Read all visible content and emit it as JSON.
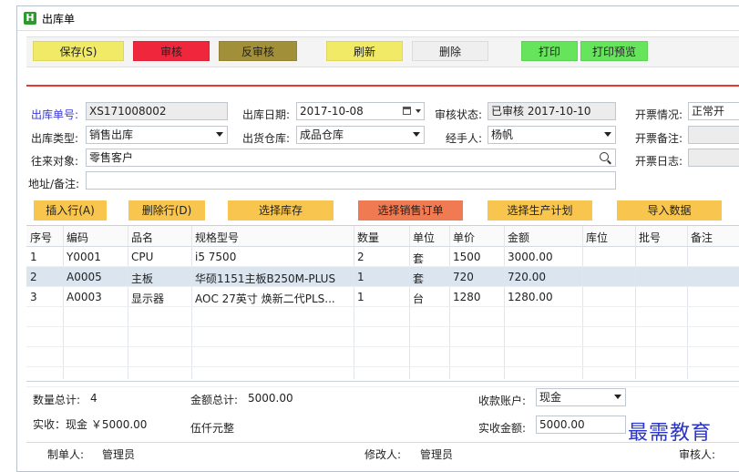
{
  "window": {
    "title": "出库单",
    "icon_letter": "H"
  },
  "toolbar": [
    {
      "label": "保存(S)",
      "color": "#f0ea67"
    },
    {
      "label": "审核",
      "color": "#f0263c"
    },
    {
      "label": "反审核",
      "color": "#a18f3a"
    },
    {
      "label": "刷新",
      "color": "#f0ea67"
    },
    {
      "label": "删除",
      "color": "#efefef"
    },
    {
      "label": "打印",
      "color": "#66e45c"
    },
    {
      "label": "打印预览",
      "color": "#66e45c"
    }
  ],
  "form": {
    "order_no_label": "出库单号:",
    "order_no": "XS171008002",
    "date_label": "出库日期:",
    "date": "2017-10-08",
    "audit_status_label": "审核状态:",
    "audit_status": "已审核 2017-10-10",
    "invoice_status_label": "开票情况:",
    "invoice_status": "正常开",
    "type_label": "出库类型:",
    "type": "销售出库",
    "warehouse_label": "出货仓库:",
    "warehouse": "成品仓库",
    "handler_label": "经手人:",
    "handler": "杨帆",
    "invoice_note_label": "开票备注:",
    "party_label": "往来对象:",
    "party": "零售客户",
    "invoice_log_label": "开票日志:",
    "address_label": "地址/备注:",
    "address": ""
  },
  "actions": [
    {
      "label": "插入行(A)"
    },
    {
      "label": "删除行(D)"
    },
    {
      "label": "选择库存"
    },
    {
      "label": "选择销售订单"
    },
    {
      "label": "选择生产计划"
    },
    {
      "label": "导入数据"
    }
  ],
  "table": {
    "columns": [
      "序号",
      "编码",
      "品名",
      "规格型号",
      "数量",
      "单位",
      "单价",
      "金额",
      "库位",
      "批号",
      "备注"
    ],
    "rows": [
      [
        "1",
        "Y0001",
        "CPU",
        "i5 7500",
        "2",
        "套",
        "1500",
        "3000.00",
        "",
        "",
        ""
      ],
      [
        "2",
        "A0005",
        "主板",
        "华硕1151主板B250M-PLUS",
        "1",
        "套",
        "720",
        "720.00",
        "",
        "",
        ""
      ],
      [
        "3",
        "A0003",
        "显示器",
        "AOC 27英寸 焕新二代PLS...",
        "1",
        "台",
        "1280",
        "1280.00",
        "",
        "",
        ""
      ]
    ]
  },
  "summary": {
    "qty_label": "数量总计:",
    "qty": "4",
    "amount_label": "金额总计:",
    "amount": "5000.00",
    "account_label": "收款账户:",
    "account": "现金",
    "received_text": "实收：现金 ￥5000.00",
    "amount_words": "伍仟元整",
    "actual_label": "实收金额:",
    "actual": "5000.00"
  },
  "footer": {
    "maker_label": "制单人:",
    "maker": "管理员",
    "modifier_label": "修改人:",
    "modifier": "管理员",
    "auditor_label": "审核人:"
  },
  "watermark": "最需教育"
}
